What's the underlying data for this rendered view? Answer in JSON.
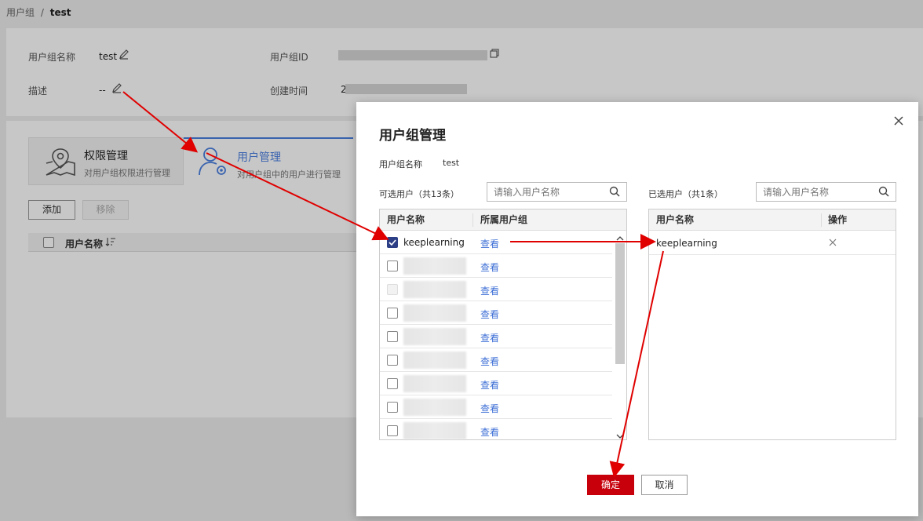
{
  "breadcrumb": {
    "parent": "用户组",
    "separator": "/",
    "current": "test"
  },
  "info": {
    "name_label": "用户组名称",
    "name_value": "test",
    "id_label": "用户组ID",
    "desc_label": "描述",
    "desc_value": "--",
    "created_label": "创建时间",
    "created_prefix": "2"
  },
  "tabs": [
    {
      "title": "权限管理",
      "subtitle": "对用户组权限进行管理",
      "icon": "map-pin-icon"
    },
    {
      "title": "用户管理",
      "subtitle": "对用户组中的用户进行管理",
      "icon": "user-settings-icon"
    }
  ],
  "actions": {
    "add": "添加",
    "remove": "移除"
  },
  "bg_table": {
    "col_name": "用户名称",
    "sort_icon": "sort-icon"
  },
  "dialog": {
    "title": "用户组管理",
    "close_icon": "close-icon",
    "group_label": "用户组名称",
    "group_value": "test",
    "available": {
      "label": "可选用户（共13条）",
      "search_placeholder": "请输入用户名称",
      "col_name": "用户名称",
      "col_groups": "所属用户组",
      "rows": [
        {
          "name": "keeplearning",
          "checked": true,
          "view": "查看"
        },
        {
          "name": "",
          "checked": false,
          "view": "查看"
        },
        {
          "name": "",
          "checked": false,
          "disabled": true,
          "view": "查看"
        },
        {
          "name": "",
          "checked": false,
          "view": "查看"
        },
        {
          "name": "",
          "checked": false,
          "view": "查看"
        },
        {
          "name": "",
          "checked": false,
          "view": "查看"
        },
        {
          "name": "",
          "checked": false,
          "view": "查看"
        },
        {
          "name": "",
          "checked": false,
          "view": "查看"
        },
        {
          "name": "",
          "checked": false,
          "view": "查看"
        }
      ]
    },
    "selected": {
      "label": "已选用户（共1条）",
      "search_placeholder": "请输入用户名称",
      "col_name": "用户名称",
      "col_action": "操作",
      "rows": [
        {
          "name": "keeplearning",
          "remove_icon": "remove-x-icon"
        }
      ]
    },
    "confirm": "确定",
    "cancel": "取消"
  },
  "colors": {
    "accent": "#4a7fe0",
    "primary_button": "#c7000b",
    "link": "#3e6fd6",
    "annotation_arrow": "#e00000"
  }
}
